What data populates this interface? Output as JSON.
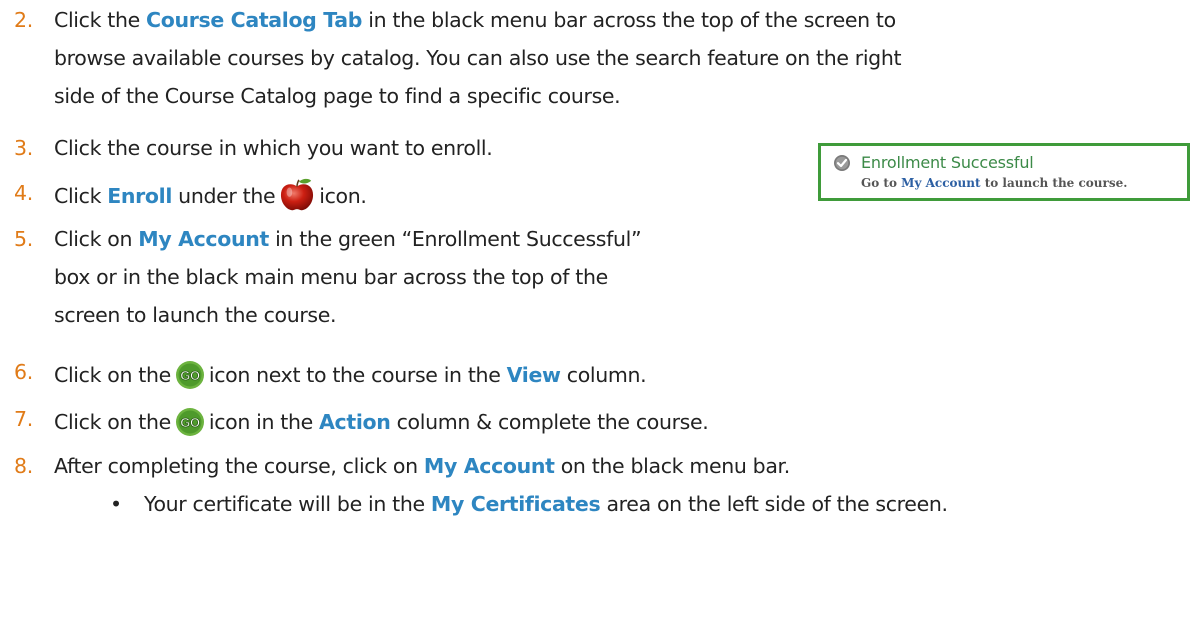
{
  "steps": [
    {
      "num": "2.",
      "lines": [
        [
          "Click the ",
          {
            "hl": "Course Catalog Tab"
          },
          " in the black menu bar across the top of the screen to"
        ],
        [
          "browse available courses by catalog. You can also use the search feature on the right"
        ],
        [
          "side of the Course Catalog page to find a specific course."
        ]
      ]
    },
    {
      "num": "3.",
      "text": "Click the course in which you want to enroll."
    },
    {
      "num": "4.",
      "pre": "Click ",
      "hl": "Enroll",
      "mid": " under the",
      "post": "icon.",
      "icon": "apple-icon"
    },
    {
      "num": "5.",
      "lines": [
        [
          "Click on ",
          {
            "hl": "My Account"
          },
          " in the green “Enrollment Successful”"
        ],
        [
          "box or in the black main menu bar across the top of the"
        ],
        [
          "screen to launch the course."
        ]
      ]
    },
    {
      "num": "6.",
      "pre": "Click on the",
      "post": "icon next to the course in the ",
      "hl": "View",
      "tail": " column.",
      "icon": "go-icon"
    },
    {
      "num": "7.",
      "pre": "Click on the",
      "post": "icon in the ",
      "hl": "Action",
      "tail": " column & complete the course.",
      "icon": "go-icon"
    },
    {
      "num": "8.",
      "pre": "After completing the course, click on ",
      "hl": "My Account",
      "tail": " on the black menu bar."
    }
  ],
  "bullet": {
    "symbol": "•",
    "pre": "Your certificate will be in the ",
    "hl": "My Certificates",
    "tail": " area on the left side of the screen."
  },
  "success_box": {
    "title": "Enrollment Successful",
    "sub_pre": "Go to ",
    "sub_link": "My Account",
    "sub_post": " to launch the course."
  },
  "colors": {
    "number": "#E07B18",
    "highlight": "#2E86C1",
    "box_border": "#3F9B3A"
  }
}
